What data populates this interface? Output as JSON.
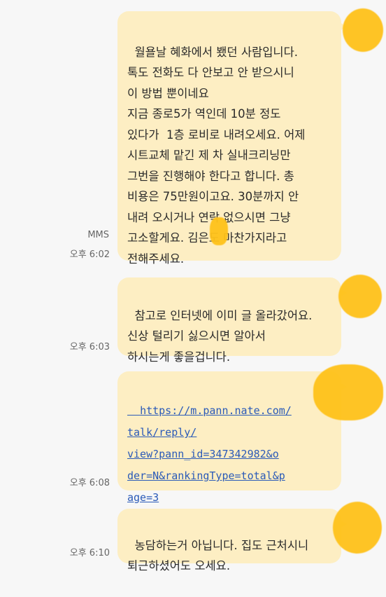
{
  "messages": [
    {
      "text": "월욜날 혜화에서 뵀던 사람입니다.\n톡도 전화도 다 안보고 안 받으시니\n이 방법 뿐이네요\n지금 종로5가 역인데 10분 정도\n있다가  1층 로비로 내려오세요. 어제\n시트교체 맡긴 제 차 실내크리닝만\n그번을 진행해야 한다고 합니다. 총\n비용은 75만원이고요. 30분까지 안\n내려 오시거나 연락 없으시면 그냥\n고소할게요. 김은도 마찬가지라고\n전해주세요.",
      "type_label": "MMS",
      "time": "오후 6:02"
    },
    {
      "text": "참고로 인터넷에 이미 글 올라갔어요.\n신상 털리기 싫으시면 알아서\n하시는게 좋을겁니다.",
      "type_label": "",
      "time": "오후 6:03"
    },
    {
      "text": "https://m.pann.nate.com/\ntalk/reply/\nview?pann_id=347342982&o\nder=N&rankingType=total&p\nage=3",
      "type_label": "",
      "time": "오후 6:08"
    },
    {
      "text": "농담하는거 아닙니다. 집도 근처시니\n퇴근하셨어도 오세요.",
      "type_label": "",
      "time": "오후 6:10"
    }
  ],
  "colors": {
    "bubble": "#fdeec3",
    "background": "#f7f7f7",
    "link": "#2a5ab8",
    "redaction": "#ffc21a"
  }
}
